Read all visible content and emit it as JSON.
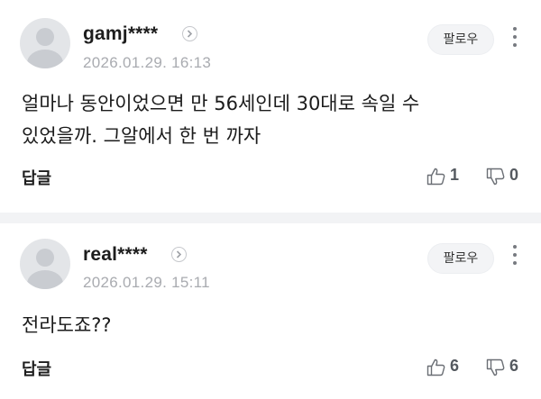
{
  "comments": [
    {
      "username": "gamj****",
      "timestamp": "2026.01.29. 16:13",
      "follow_label": "팔로우",
      "text_lines": [
        "얼마나 동안이었으면 만 56세인데 30대로 속일 수",
        "있었을까. 그알에서 한 번 까자"
      ],
      "reply_label": "답글",
      "likes": "1",
      "dislikes": "0"
    },
    {
      "username": "real****",
      "timestamp": "2026.01.29. 15:11",
      "follow_label": "팔로우",
      "text_lines": [
        "전라도죠??"
      ],
      "reply_label": "답글",
      "likes": "6",
      "dislikes": "6"
    }
  ],
  "icons": {
    "avatar": "default-avatar-icon",
    "profile": "chevron-right-icon",
    "more": "more-vertical-icon",
    "like": "thumbs-up-icon",
    "dislike": "thumbs-down-icon"
  },
  "colors": {
    "timestamp": "#a9abb0",
    "follow_bg": "#f3f4f6",
    "divider": "#f2f3f5",
    "avatar_bg": "#e3e5e8"
  }
}
